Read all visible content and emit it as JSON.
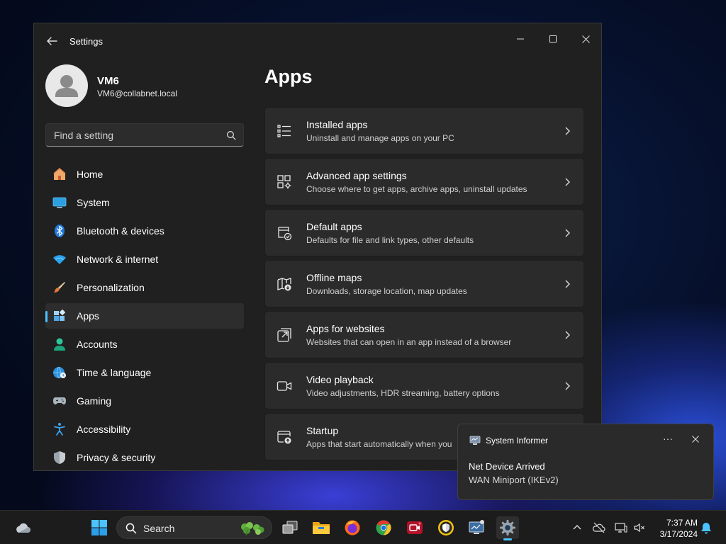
{
  "window": {
    "title": "Settings",
    "controls": {
      "minimize": "minimize",
      "maximize": "maximize",
      "close": "close"
    }
  },
  "profile": {
    "name": "VM6",
    "email": "VM6@collabnet.local"
  },
  "search": {
    "placeholder": "Find a setting"
  },
  "sidebar": {
    "items": [
      {
        "label": "Home",
        "icon": "home-icon"
      },
      {
        "label": "System",
        "icon": "system-icon"
      },
      {
        "label": "Bluetooth & devices",
        "icon": "bluetooth-icon"
      },
      {
        "label": "Network & internet",
        "icon": "wifi-icon"
      },
      {
        "label": "Personalization",
        "icon": "brush-icon"
      },
      {
        "label": "Apps",
        "icon": "apps-icon",
        "active": true
      },
      {
        "label": "Accounts",
        "icon": "account-icon"
      },
      {
        "label": "Time & language",
        "icon": "globe-clock-icon"
      },
      {
        "label": "Gaming",
        "icon": "gamepad-icon"
      },
      {
        "label": "Accessibility",
        "icon": "accessibility-icon"
      },
      {
        "label": "Privacy & security",
        "icon": "shield-icon"
      }
    ]
  },
  "main": {
    "title": "Apps",
    "cards": [
      {
        "title": "Installed apps",
        "desc": "Uninstall and manage apps on your PC",
        "icon": "list-icon"
      },
      {
        "title": "Advanced app settings",
        "desc": "Choose where to get apps, archive apps, uninstall updates",
        "icon": "app-settings-icon"
      },
      {
        "title": "Default apps",
        "desc": "Defaults for file and link types, other defaults",
        "icon": "default-apps-icon"
      },
      {
        "title": "Offline maps",
        "desc": "Downloads, storage location, map updates",
        "icon": "map-download-icon"
      },
      {
        "title": "Apps for websites",
        "desc": "Websites that can open in an app instead of a browser",
        "icon": "open-in-app-icon"
      },
      {
        "title": "Video playback",
        "desc": "Video adjustments, HDR streaming, battery options",
        "icon": "video-icon"
      },
      {
        "title": "Startup",
        "desc": "Apps that start automatically when you",
        "icon": "startup-icon"
      }
    ]
  },
  "notification": {
    "app": "System Informer",
    "title": "Net Device Arrived",
    "body": "WAN Miniport (IKEv2)",
    "more": "···"
  },
  "taskbar": {
    "search_label": "Search",
    "time": "7:37 AM",
    "date": "3/17/2024"
  },
  "colors": {
    "accent": "#4cc2ff",
    "window_bg": "#202020",
    "card_bg": "#2b2b2b"
  }
}
